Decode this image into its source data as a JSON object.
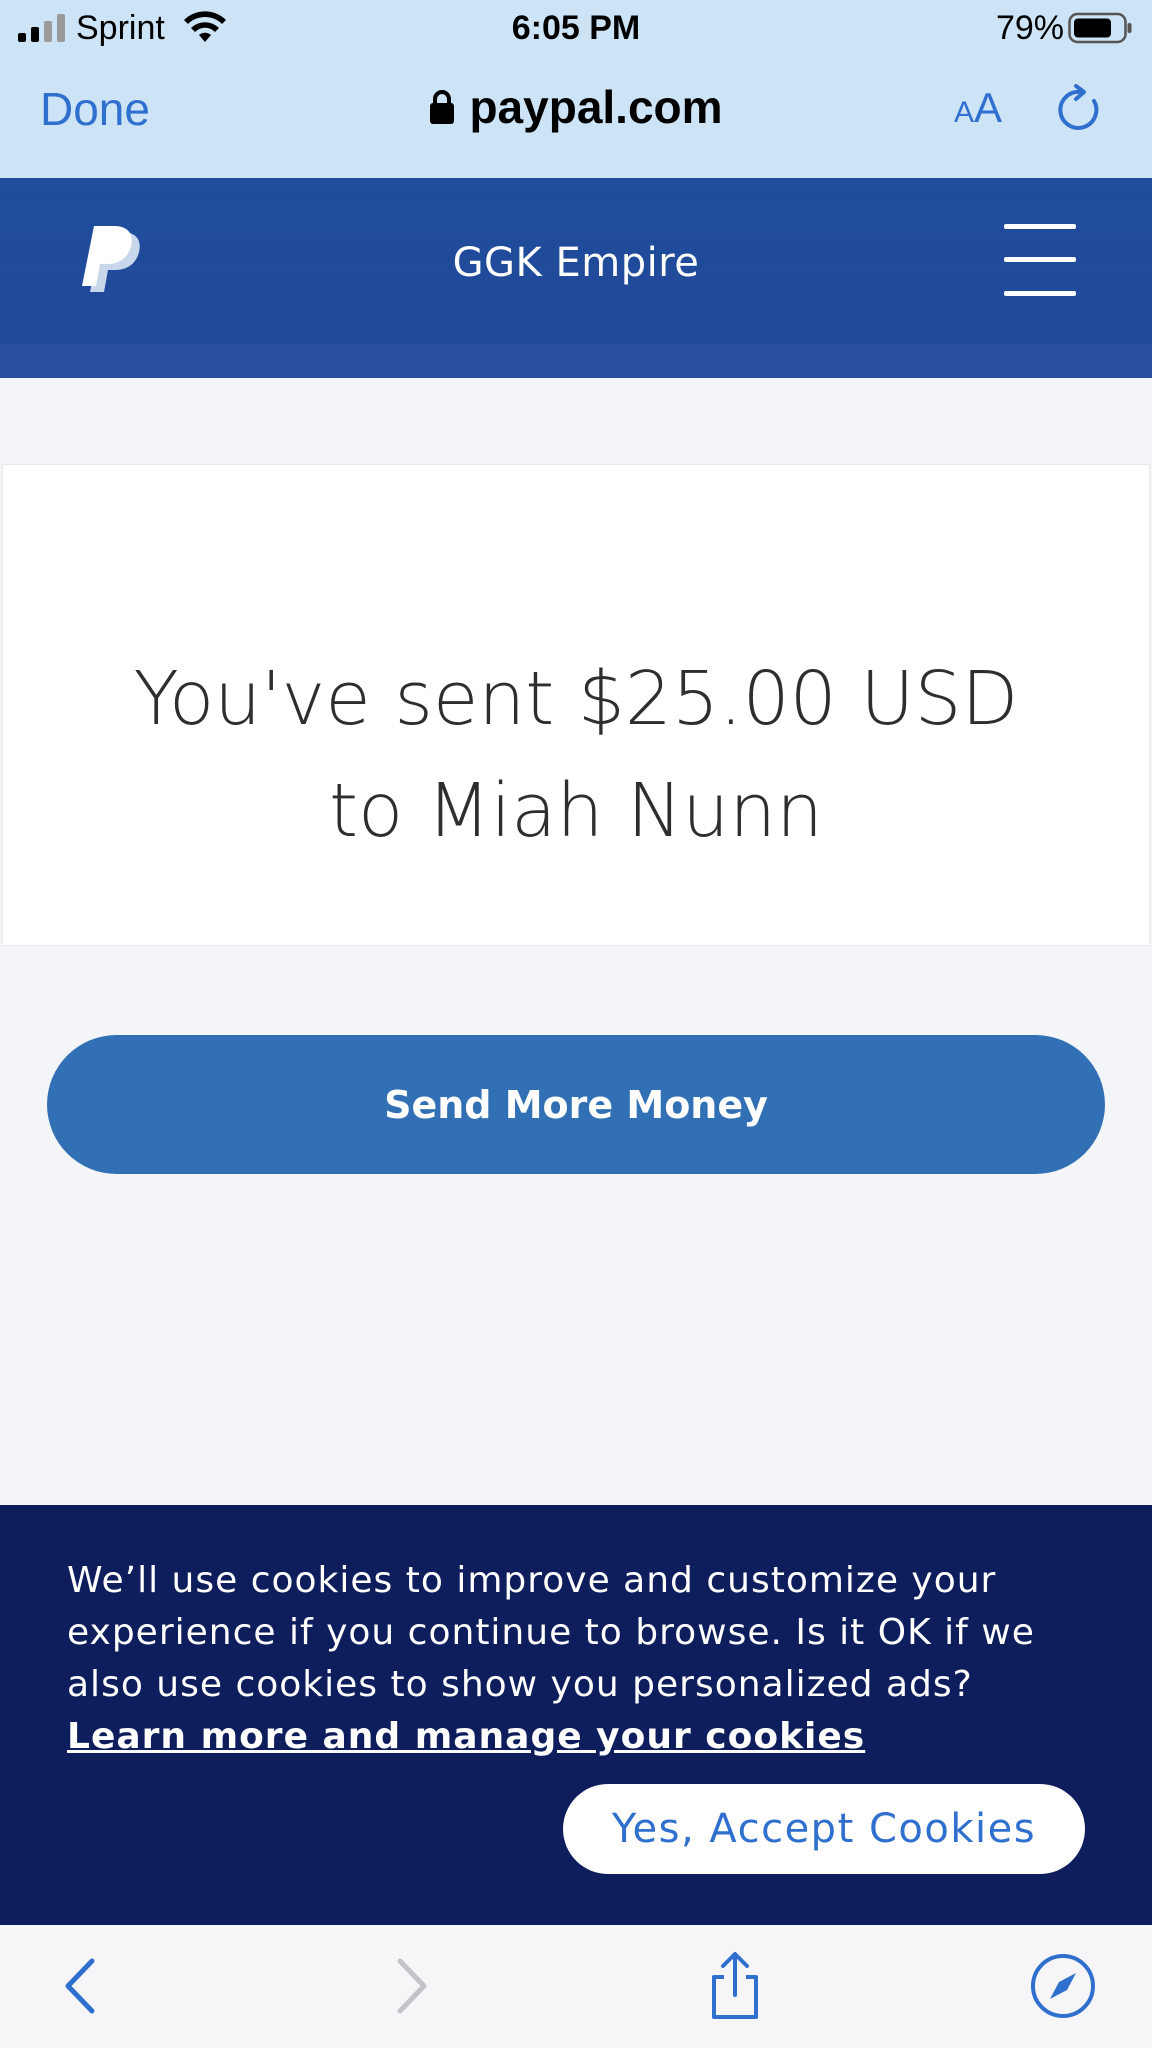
{
  "status_bar": {
    "carrier": "Sprint",
    "time": "6:05 PM",
    "battery_percent": "79%"
  },
  "browser": {
    "done_label": "Done",
    "url": "paypal.com",
    "text_size_label": "AA",
    "accent_color": "#2f6fce"
  },
  "header": {
    "title": "GGK Empire",
    "background_color": "#24489a"
  },
  "confirmation": {
    "line1": "You've sent $25.00 USD",
    "line2": "to Miah Nunn"
  },
  "actions": {
    "send_more_label": "Send More Money",
    "button_color": "#3270b5"
  },
  "cookie_banner": {
    "message": "We’ll use cookies to improve and customize your experience if you continue to browse. Is it OK if we also use cookies to show you personalized ads?",
    "link_text": "Learn more and manage your cookies",
    "accept_label": "Yes, Accept Cookies",
    "background_color": "#0e1d5c"
  },
  "toolbar": {
    "icons": [
      "back-icon",
      "forward-icon",
      "share-icon",
      "compass-icon"
    ]
  }
}
